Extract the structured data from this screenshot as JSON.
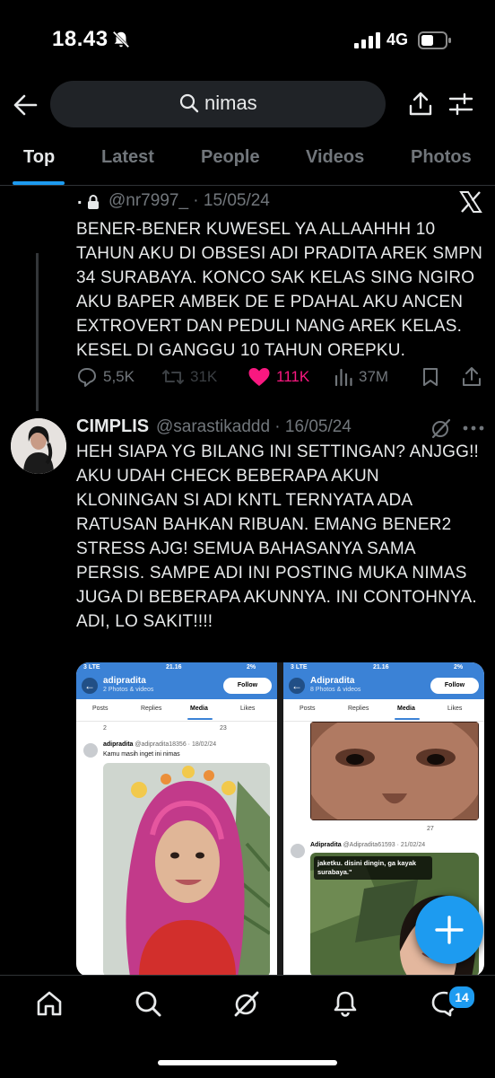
{
  "status_bar": {
    "time": "18.43",
    "network": "4G"
  },
  "search": {
    "query": "nimas"
  },
  "tabs": [
    {
      "label": "Top",
      "active": true
    },
    {
      "label": "Latest",
      "active": false
    },
    {
      "label": "People",
      "active": false
    },
    {
      "label": "Videos",
      "active": false
    },
    {
      "label": "Photos",
      "active": false
    }
  ],
  "tweet1": {
    "name": ".",
    "handle": "@nr7997_ · 15/05/24",
    "text": "BENER-BENER KUWESEL YA ALLAAHHH 10 TAHUN AKU DI OBSESI ADI PRADITA AREK SMPN 34 SURABAYA. KONCO SAK KELAS SING NGIRO AKU BAPER AMBEK DE E PDAHAL AKU ANCEN EXTROVERT DAN PEDULI NANG AREK KELAS. KESEL DI GANGGU 10 TAHUN OREPKU.",
    "replies": "5,5K",
    "reposts": "31K",
    "likes": "111K",
    "views": "37M"
  },
  "tweet2": {
    "name": "CIMPLIS",
    "handle": "@sarastikaddd · 16/05/24",
    "text": "HEH SIAPA YG BILANG INI SETTINGAN? ANJGG!!\nAKU UDAH CHECK BEBERAPA AKUN KLONINGAN SI ADI KNTL TERNYATA ADA RATUSAN BAHKAN RIBUAN. EMANG BENER2 STRESS AJG! SEMUA BAHASANYA SAMA PERSIS. SAMPE ADI INI POSTING MUKA NIMAS JUGA DI BEBERAPA AKUNNYA. INI CONTOHNYA. ADI, LO SAKIT!!!!"
  },
  "embedded_left": {
    "status_left": "3 LTE",
    "status_time": "21.16",
    "status_right": "2%",
    "profile_name": "adipradita",
    "profile_sub": "2 Photos & videos",
    "follow_label": "Follow",
    "tabs": [
      "Posts",
      "Replies",
      "Media",
      "Likes"
    ],
    "prev_actions": [
      "2",
      "23"
    ],
    "tweet_name": "adipradita",
    "tweet_handle": "@adipradita18356 · 18/02/24",
    "tweet_text": "Kamu masih inget ini nimas"
  },
  "embedded_right": {
    "status_left": "3 LTE",
    "status_time": "21.16",
    "status_right": "2%",
    "profile_name": "Adipradita",
    "profile_sub": "8 Photos & videos",
    "follow_label": "Follow",
    "tabs": [
      "Posts",
      "Replies",
      "Media",
      "Likes"
    ],
    "prev_actions": [
      "27"
    ],
    "tweet_name": "Adipradita",
    "tweet_handle": "@Adipradita61593 · 21/02/24",
    "photo_caption": "jaketku. disini dingin, ga kayak surabaya.\""
  },
  "bottom_nav": {
    "badge": "14"
  },
  "colors": {
    "background": "#000000",
    "accent": "#1d9bf0",
    "like": "#f91880",
    "muted_text": "#71767b"
  },
  "icons": [
    "bell-off-icon",
    "signal-icon",
    "battery-icon",
    "back-arrow-icon",
    "search-icon",
    "share-icon",
    "filter-icon",
    "lock-icon",
    "x-logo-icon",
    "reply-icon",
    "repost-icon",
    "heart-icon",
    "views-icon",
    "bookmark-icon",
    "grok-icon",
    "more-icon",
    "plus-icon",
    "home-icon",
    "explore-icon",
    "grok-nav-icon",
    "notifications-icon",
    "messages-icon"
  ]
}
